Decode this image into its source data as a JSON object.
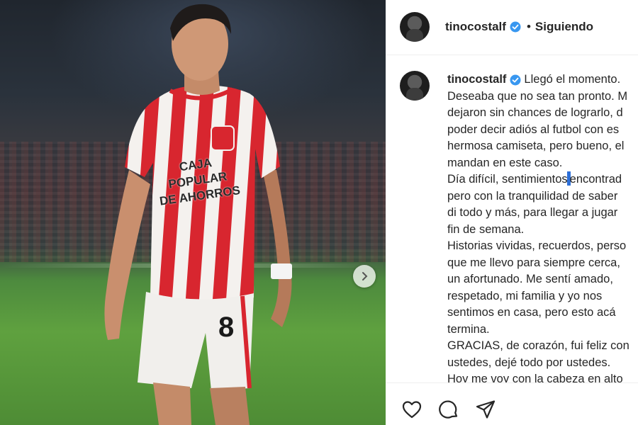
{
  "post": {
    "username": "tinocostalf",
    "follow_status": "Siguiendo",
    "separator": "•",
    "verified_icon": "verified-badge-icon",
    "brand_color": "#3897f0"
  },
  "photo": {
    "shirt_text_line1": "CAJA POPULAR",
    "shirt_text_line2": "DE AHORROS",
    "shirt_number": "8",
    "next_icon": "chevron-right-icon"
  },
  "caption": {
    "username": "tinocostalf",
    "lines": [
      "Llegó el momento.",
      "Deseaba que no sea tan pronto. M",
      "dejaron sin chances de lograrlo, d",
      "poder decir adiós al futbol con es",
      "hermosa camiseta, pero bueno, el",
      "mandan en este caso.",
      "Día difícil, sentimientos",
      "encontrad",
      "pero con la tranquilidad de saber",
      "di todo y más, para llegar a jugar",
      "fin de semana.",
      "Historias vividas, recuerdos, perso",
      "que me llevo para siempre cerca,",
      "un afortunado. Me sentí amado,",
      "respetado, mi familia y yo nos",
      "sentimos en casa, pero esto acá",
      "termina.",
      "GRACIAS, de corazón, fui feliz con",
      "ustedes, dejé todo por ustedes.",
      "Hoy me voy con la cabeza en alto"
    ]
  },
  "actions": {
    "like_icon": "heart-icon",
    "comment_icon": "comment-icon",
    "share_icon": "send-icon"
  }
}
